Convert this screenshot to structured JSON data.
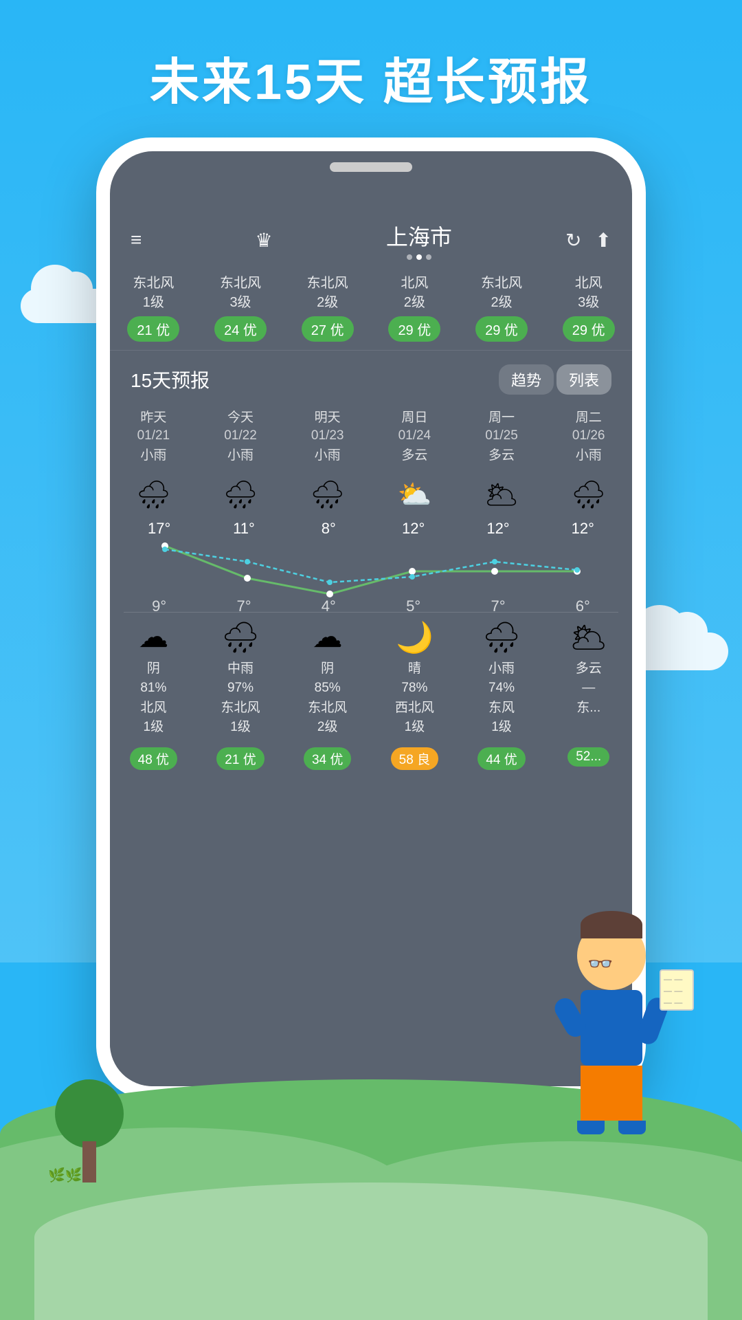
{
  "background": {
    "sky_color": "#29b6f6",
    "ground_color": "#66bb6a"
  },
  "title": "未来15天  超长预报",
  "phone": {
    "city": "上海市",
    "dots": [
      false,
      true,
      false
    ],
    "top_icons": {
      "menu": "≡",
      "crown": "♛",
      "refresh": "↻",
      "share": "⬆"
    }
  },
  "wind_row": [
    {
      "wind": "东北风\n1级",
      "aqi": "21 优",
      "aqi_type": "green"
    },
    {
      "wind": "东北风\n3级",
      "aqi": "24 优",
      "aqi_type": "green"
    },
    {
      "wind": "东北风\n2级",
      "aqi": "27 优",
      "aqi_type": "green"
    },
    {
      "wind": "北风\n2级",
      "aqi": "29 优",
      "aqi_type": "green"
    },
    {
      "wind": "东北风\n2级",
      "aqi": "29 优",
      "aqi_type": "green"
    },
    {
      "wind": "北风\n3级",
      "aqi": "29 优",
      "aqi_type": "green"
    }
  ],
  "forecast_section": {
    "title": "15天预报",
    "tabs": [
      "趋势",
      "列表"
    ],
    "active_tab": 1
  },
  "days": [
    {
      "label": "昨天",
      "date": "01/21",
      "condition": "小雨",
      "icon": "🌧",
      "high": "17°",
      "low": "9°"
    },
    {
      "label": "今天",
      "date": "01/22",
      "condition": "小雨",
      "icon": "🌧",
      "high": "11°",
      "low": "7°"
    },
    {
      "label": "明天",
      "date": "01/23",
      "condition": "小雨",
      "icon": "🌧",
      "high": "8°",
      "low": "4°"
    },
    {
      "label": "周日",
      "date": "01/24",
      "condition": "多云",
      "icon": "⛅",
      "high": "12°",
      "low": "5°"
    },
    {
      "label": "周一",
      "date": "01/25",
      "condition": "多云",
      "icon": "🌥",
      "high": "12°",
      "low": "7°"
    },
    {
      "label": "周二",
      "date": "01/26",
      "condition": "小雨",
      "icon": "🌧",
      "high": "12°",
      "low": "6°"
    }
  ],
  "bottom_days": [
    {
      "icon": "☁",
      "condition": "阴",
      "humidity": "81%",
      "wind": "北风\n1级",
      "aqi": "48 优",
      "aqi_type": "green"
    },
    {
      "icon": "🌧",
      "condition": "中雨",
      "humidity": "97%",
      "wind": "东北风\n1级",
      "aqi": "21 优",
      "aqi_type": "green"
    },
    {
      "icon": "☁",
      "condition": "阴",
      "humidity": "85%",
      "wind": "东北风\n2级",
      "aqi": "34 优",
      "aqi_type": "green"
    },
    {
      "icon": "🌙",
      "condition": "晴",
      "humidity": "78%",
      "wind": "西北风\n1级",
      "aqi": "58 良",
      "aqi_type": "yellow"
    },
    {
      "icon": "🌧",
      "condition": "小雨",
      "humidity": "74%",
      "wind": "东风\n1级",
      "aqi": "44 优",
      "aqi_type": "green"
    },
    {
      "icon": "🌥",
      "condition": "多云",
      "humidity": "–",
      "wind": "东...",
      "aqi": "52...",
      "aqi_type": "green"
    }
  ]
}
